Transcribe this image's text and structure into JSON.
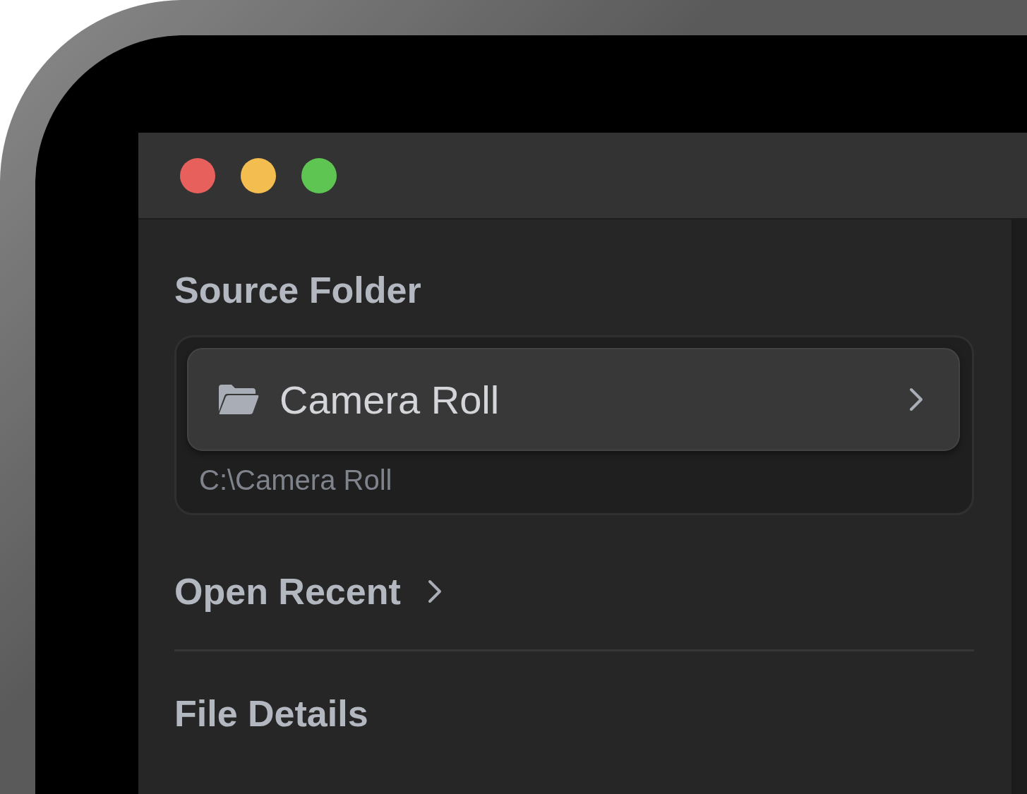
{
  "window": {
    "controls": [
      {
        "color": "#e8605c"
      },
      {
        "color": "#f4bd4f"
      },
      {
        "color": "#5ec452"
      }
    ]
  },
  "sidebar": {
    "source_folder": {
      "heading": "Source Folder",
      "folder_button": {
        "label": "Camera Roll"
      },
      "path": "C:\\Camera Roll"
    },
    "open_recent": {
      "heading": "Open Recent"
    },
    "file_details": {
      "heading": "File Details"
    }
  }
}
